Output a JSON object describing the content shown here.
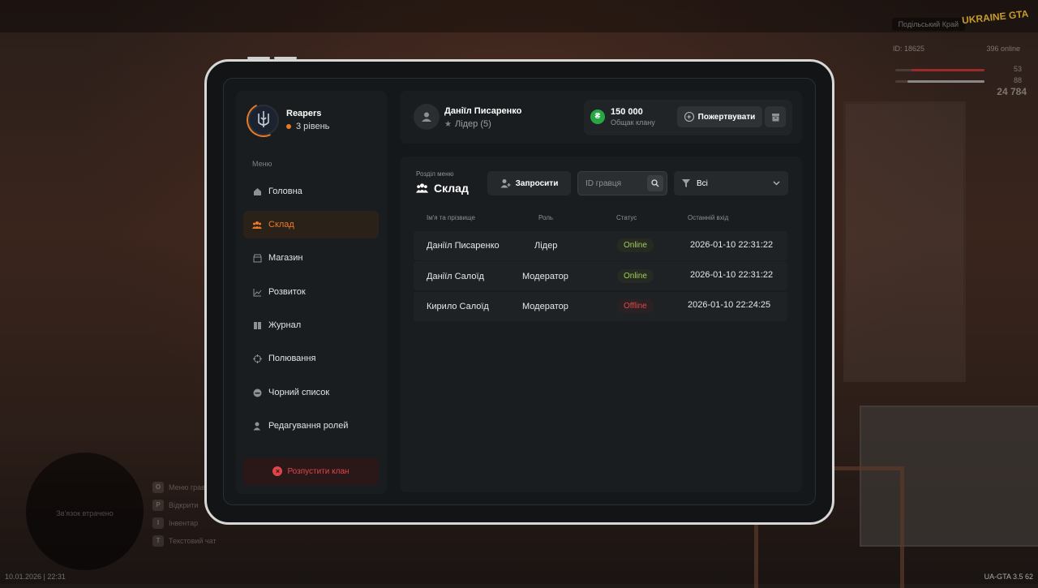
{
  "hud": {
    "server": "Подільський Край",
    "logo": "UKRAINE GTA",
    "player_id": "ID: 18625",
    "online": "396 online",
    "health": "53",
    "armor": "88",
    "money": "24 784",
    "map_text": "Зв'язок втрачено",
    "binds": [
      {
        "key": "O",
        "label": "Меню гравця"
      },
      {
        "key": "P",
        "label": "Відкрити"
      },
      {
        "key": "I",
        "label": "Інвентар"
      },
      {
        "key": "T",
        "label": "Текстовий чат"
      }
    ],
    "datetime": "10.01.2026 | 22:31",
    "version": "UA-GTA 3.5",
    "fps": "62"
  },
  "clan": {
    "name": "Reapers",
    "level": "3 рівень"
  },
  "menu": {
    "title": "Меню",
    "items": [
      {
        "label": "Головна",
        "icon": "home-icon"
      },
      {
        "label": "Склад",
        "icon": "users-icon"
      },
      {
        "label": "Магазин",
        "icon": "shop-icon"
      },
      {
        "label": "Розвиток",
        "icon": "chart-icon"
      },
      {
        "label": "Журнал",
        "icon": "book-icon"
      },
      {
        "label": "Полювання",
        "icon": "crosshair-icon"
      },
      {
        "label": "Чорний список",
        "icon": "block-icon"
      },
      {
        "label": "Редагування ролей",
        "icon": "user-edit-icon"
      }
    ],
    "active_index": 1,
    "disband_label": "Розпустити клан"
  },
  "user": {
    "name": "Даніїл Писаренко",
    "role": "Лідер (5)"
  },
  "treasury": {
    "amount": "150 000",
    "label": "Общак клану",
    "donate_label": "Пожертвувати"
  },
  "section": {
    "caption": "Розділ меню",
    "title": "Склад",
    "invite_label": "Запросити",
    "search_placeholder": "ID гравця",
    "filter_value": "Всі"
  },
  "table": {
    "headers": [
      "Ім'я та прізвище",
      "Роль",
      "Статус",
      "Останній вхід"
    ],
    "rows": [
      {
        "name": "Даніїл Писаренко",
        "role": "Лідер",
        "status": "Online",
        "last_login": "2026-01-10 22:31:22"
      },
      {
        "name": "Даніїл Салоїд",
        "role": "Модератор",
        "status": "Online",
        "last_login": "2026-01-10 22:31:22"
      },
      {
        "name": "Кирило Салоїд",
        "role": "Модератор",
        "status": "Offline",
        "last_login": "2026-01-10 22:24:25"
      }
    ]
  },
  "colors": {
    "accent": "#f07a2a",
    "online": "#9fd05a",
    "offline": "#e0454b",
    "coin": "#27a744"
  }
}
